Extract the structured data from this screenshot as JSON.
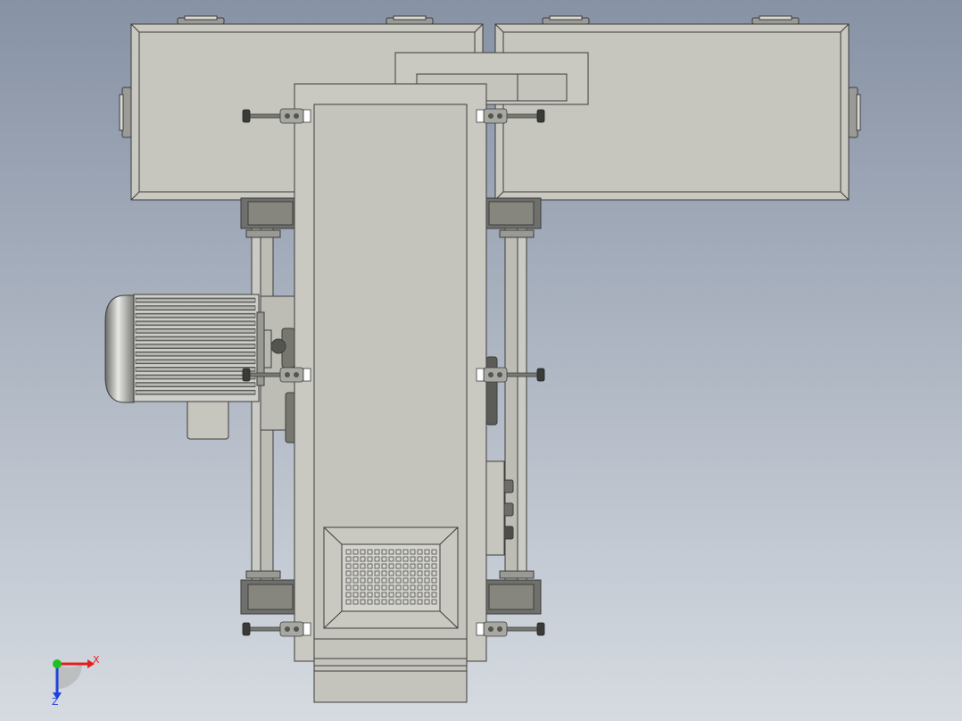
{
  "colors": {
    "bg_top": "#8894a6",
    "bg_bottom": "#d5dae0",
    "part_fill": "#c8c8c0",
    "part_light": "#d6d6ce",
    "edge": "#3c3c3c",
    "dark_steel": "#6a6a66",
    "axis_x": "#e02020",
    "axis_y": "#20c020",
    "axis_z": "#2040e0"
  },
  "triad": {
    "x_label": "X",
    "z_label": "Z"
  }
}
